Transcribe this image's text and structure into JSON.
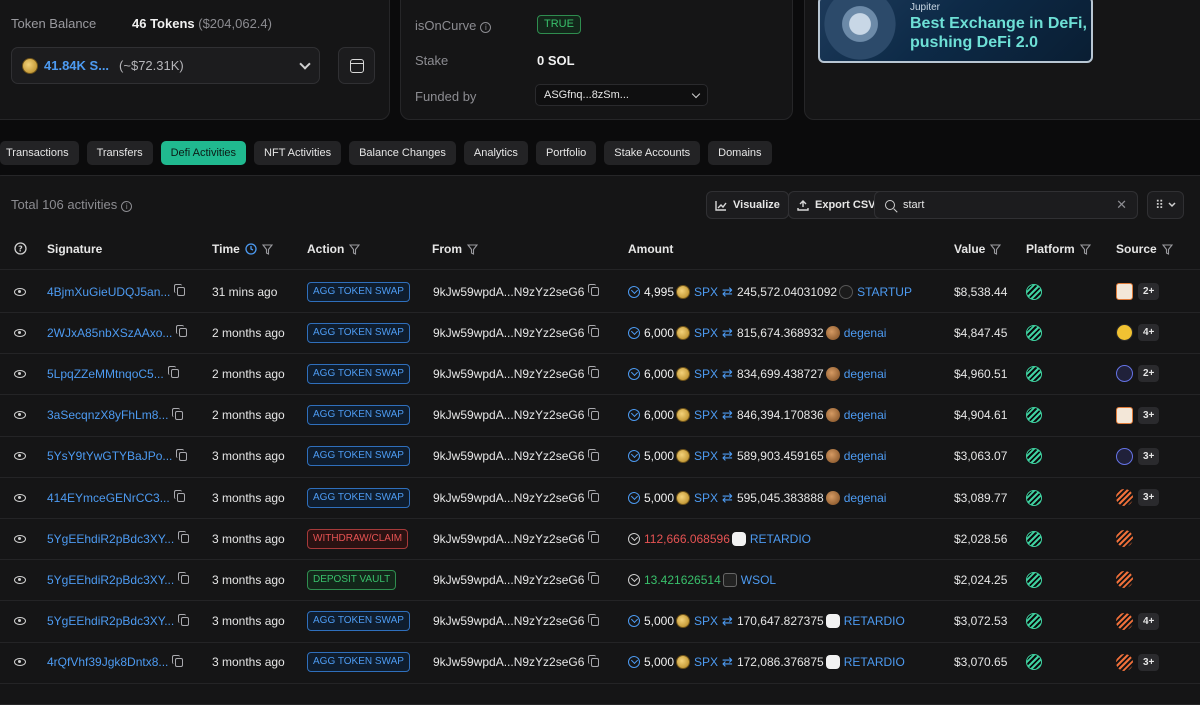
{
  "balance": {
    "label": "Token Balance",
    "value": "46 Tokens",
    "usd": "($204,062.4)",
    "token_amount": "41.84K S...",
    "token_usd": "(~$72.31K)"
  },
  "details": {
    "is_on_curve_label": "isOnCurve",
    "is_on_curve_value": "TRUE",
    "stake_label": "Stake",
    "stake_value": "0 SOL",
    "funded_label": "Funded by",
    "funded_value": "ASGfnq...8zSm..."
  },
  "ad": {
    "sub": "Jupiter",
    "title_line1": "Best Exchange in DeFi,",
    "title_line2": "pushing DeFi 2.0"
  },
  "tabs": [
    "Transactions",
    "Transfers",
    "Defi Activities",
    "NFT Activities",
    "Balance Changes",
    "Analytics",
    "Portfolio",
    "Stake Accounts",
    "Domains"
  ],
  "table": {
    "total": "Total 106 activities",
    "visualize": "Visualize",
    "export": "Export CSV",
    "search_value": "start",
    "headers": {
      "signature": "Signature",
      "time": "Time",
      "action": "Action",
      "from": "From",
      "amount": "Amount",
      "value": "Value",
      "platform": "Platform",
      "source": "Source"
    },
    "rows": [
      {
        "sig": "4BjmXuGieUDQJ5an...",
        "time": "31 mins ago",
        "action": "AGG TOKEN SWAP",
        "from": "9kJw59wpdA...N9zYz2seG6",
        "amt1": "4,995",
        "tok1": "SPX",
        "amt2": "245,572.04031092",
        "tok2": "STARTUP",
        "value": "$8,538.44",
        "more": "2+"
      },
      {
        "sig": "2WJxA85nbXSzAAxo...",
        "time": "2 months ago",
        "action": "AGG TOKEN SWAP",
        "from": "9kJw59wpdA...N9zYz2seG6",
        "amt1": "6,000",
        "tok1": "SPX",
        "amt2": "815,674.368932",
        "tok2": "degenai",
        "value": "$4,847.45",
        "more": "4+"
      },
      {
        "sig": "5LpqZZeMMtnqoC5...",
        "time": "2 months ago",
        "action": "AGG TOKEN SWAP",
        "from": "9kJw59wpdA...N9zYz2seG6",
        "amt1": "6,000",
        "tok1": "SPX",
        "amt2": "834,699.438727",
        "tok2": "degenai",
        "value": "$4,960.51",
        "more": "2+"
      },
      {
        "sig": "3aSecqnzX8yFhLm8...",
        "time": "2 months ago",
        "action": "AGG TOKEN SWAP",
        "from": "9kJw59wpdA...N9zYz2seG6",
        "amt1": "6,000",
        "tok1": "SPX",
        "amt2": "846,394.170836",
        "tok2": "degenai",
        "value": "$4,904.61",
        "more": "3+"
      },
      {
        "sig": "5YsY9tYwGTYBaJPo...",
        "time": "3 months ago",
        "action": "AGG TOKEN SWAP",
        "from": "9kJw59wpdA...N9zYz2seG6",
        "amt1": "5,000",
        "tok1": "SPX",
        "amt2": "589,903.459165",
        "tok2": "degenai",
        "value": "$3,063.07",
        "more": "3+"
      },
      {
        "sig": "414EYmceGENrCC3...",
        "time": "3 months ago",
        "action": "AGG TOKEN SWAP",
        "from": "9kJw59wpdA...N9zYz2seG6",
        "amt1": "5,000",
        "tok1": "SPX",
        "amt2": "595,045.383888",
        "tok2": "degenai",
        "value": "$3,089.77",
        "more": "3+"
      },
      {
        "sig": "5YgEEhdiR2pBdc3XY...",
        "time": "3 months ago",
        "action": "WITHDRAW/CLAIM",
        "from": "9kJw59wpdA...N9zYz2seG6",
        "amt1": "112,666.068596",
        "tok1": "RETARDIO",
        "amt2": "",
        "tok2": "",
        "value": "$2,028.56",
        "more": ""
      },
      {
        "sig": "5YgEEhdiR2pBdc3XY...",
        "time": "3 months ago",
        "action": "DEPOSIT VAULT",
        "from": "9kJw59wpdA...N9zYz2seG6",
        "amt1": "13.421626514",
        "tok1": "WSOL",
        "amt2": "",
        "tok2": "",
        "value": "$2,024.25",
        "more": ""
      },
      {
        "sig": "5YgEEhdiR2pBdc3XY...",
        "time": "3 months ago",
        "action": "AGG TOKEN SWAP",
        "from": "9kJw59wpdA...N9zYz2seG6",
        "amt1": "5,000",
        "tok1": "SPX",
        "amt2": "170,647.827375",
        "tok2": "RETARDIO",
        "value": "$3,072.53",
        "more": "4+"
      },
      {
        "sig": "4rQfVhf39Jgk8Dntx8...",
        "time": "3 months ago",
        "action": "AGG TOKEN SWAP",
        "from": "9kJw59wpdA...N9zYz2seG6",
        "amt1": "5,000",
        "tok1": "SPX",
        "amt2": "172,086.376875",
        "tok2": "RETARDIO",
        "value": "$3,070.65",
        "more": "3+"
      }
    ]
  }
}
